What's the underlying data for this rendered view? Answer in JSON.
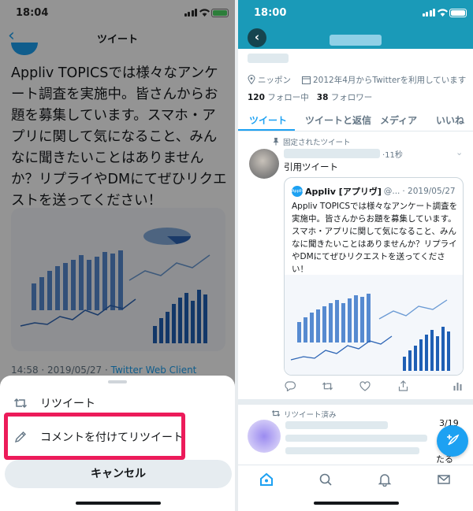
{
  "left": {
    "status": {
      "time": "18:04"
    },
    "nav": {
      "back_icon": "chevron-left-icon",
      "title": "ツイート"
    },
    "tweet": {
      "text": "Appliv TOPICSでは様々なアンケート調査を実施中。皆さんからお題を募集しています。スマホ・アプリに関して気になること、みんなに聞きたいことはありませんか？リプライやDMにてぜひリクエストを送ってください！",
      "time": "14:58 · 2019/05/27 · ",
      "client": "Twitter Web Client"
    },
    "sheet": {
      "retweet_label": "リツイート",
      "retweet_icon": "retweet-icon",
      "quote_label": "コメントを付けてリツイート",
      "quote_icon": "pencil-icon",
      "cancel_label": "キャンセル"
    },
    "colors": {
      "highlight": "#ec1b5a",
      "accent": "#1da1f2"
    }
  },
  "right": {
    "status": {
      "time": "18:00"
    },
    "profile": {
      "location": "ニッポン",
      "joined": "2012年4月からTwitterを利用しています",
      "following_count": "120",
      "following_label": "フォロー中",
      "followers_count": "38",
      "followers_label": "フォロワー"
    },
    "tabs": [
      "ツイート",
      "ツイートと返信",
      "メディア",
      "いいね"
    ],
    "pinned_tweet": {
      "pinned_label": "固定されたツイート",
      "time": "·11秒",
      "text": "引用ツイート",
      "quoted": {
        "name": "Appliv [アプリヴ]",
        "handle": "@...",
        "date": "· 2019/05/27",
        "text": "Appliv TOPICSでは様々なアンケート調査を実施中。皆さんからお題を募集しています。スマホ・アプリに関して気になること、みんなに聞きたいことはありませんか？リプライやDMにてぜひリクエストを送ってください！"
      }
    },
    "next_tweet": {
      "retweeted_label": "リツイート済み",
      "date": "3/19",
      "more": "たる"
    },
    "colors": {
      "header": "#1a9ab8",
      "accent": "#1da1f2"
    }
  }
}
